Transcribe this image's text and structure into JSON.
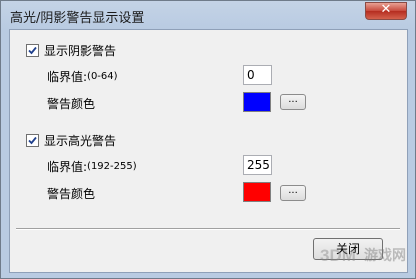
{
  "window": {
    "title": "高光/阴影警告显示设置",
    "close_glyph": "✕"
  },
  "shadow": {
    "checkbox_label": "显示阴影警告",
    "checked": true,
    "threshold_label": "临界值:",
    "threshold_range": "(0-64)",
    "threshold_value": "0",
    "color_label": "警告颜色",
    "color": "#0000ff",
    "browse_label": "..."
  },
  "highlight": {
    "checkbox_label": "显示高光警告",
    "checked": true,
    "threshold_label": "临界值:",
    "threshold_range": "(192-255)",
    "threshold_value": "255",
    "color_label": "警告颜色",
    "color": "#ff0000",
    "browse_label": "..."
  },
  "footer": {
    "close_label": "关闭"
  },
  "watermark": {
    "text": "游戏网",
    "icon": "3dm-logo-icon"
  }
}
